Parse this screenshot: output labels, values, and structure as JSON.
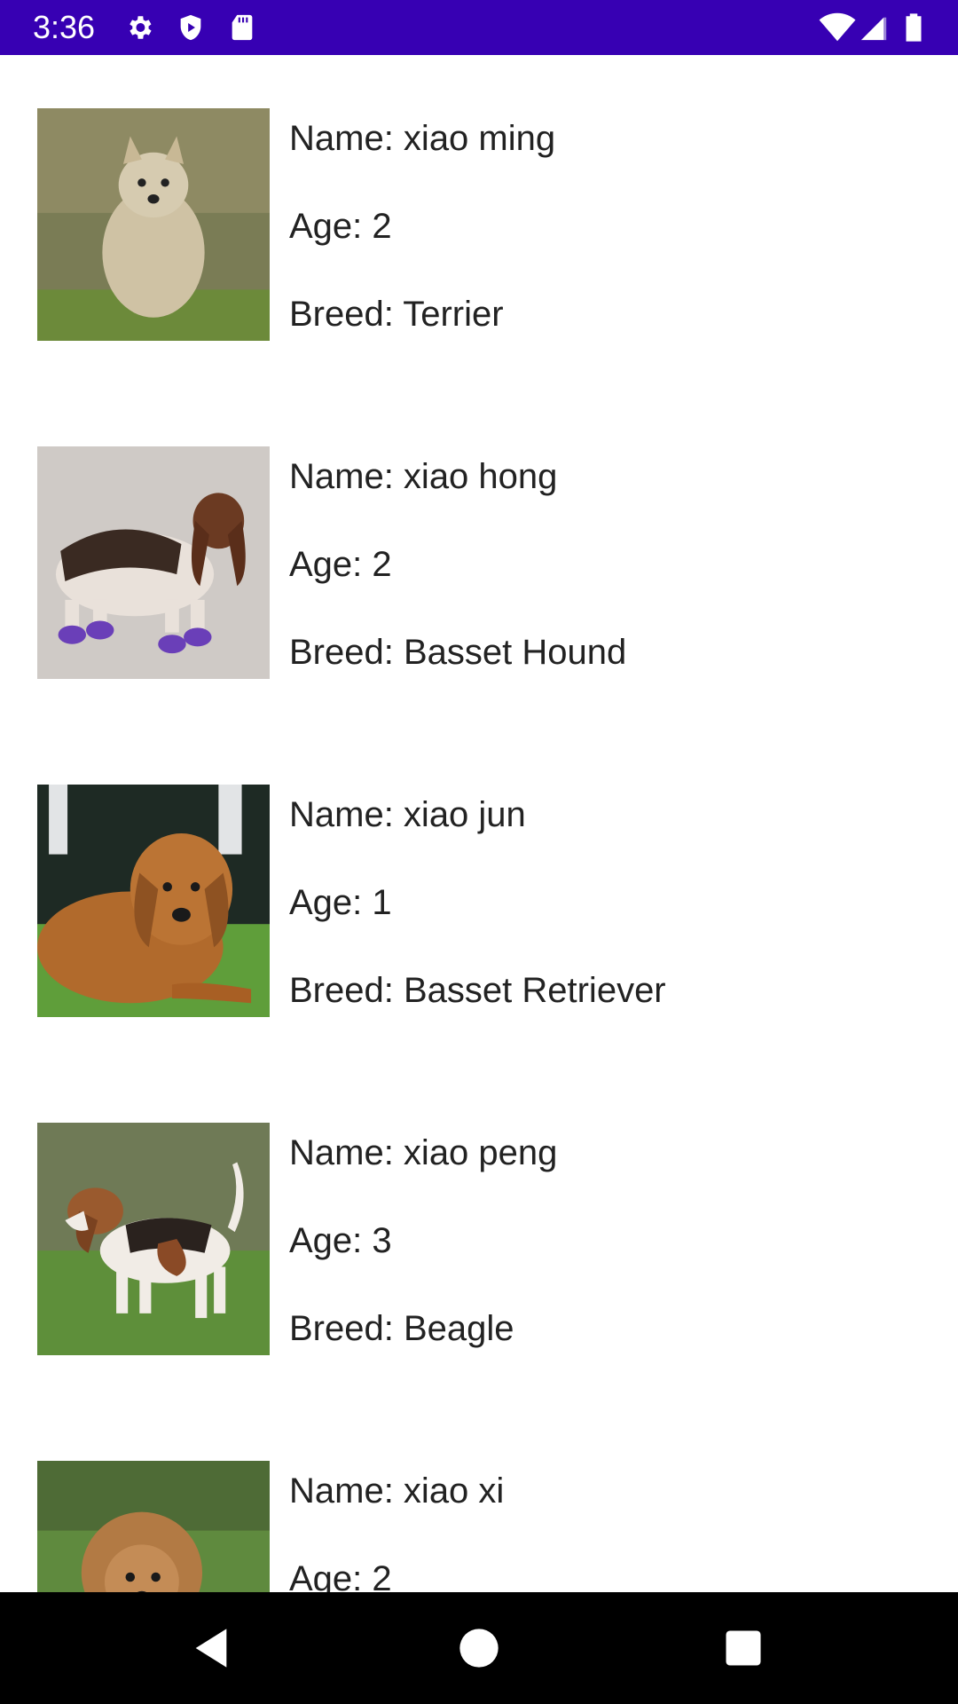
{
  "status_bar": {
    "time": "3:36",
    "left_icons": [
      "gear-icon",
      "shield-icon",
      "sd-card-icon"
    ],
    "right_icons": [
      "wifi-icon",
      "cell-signal-icon",
      "battery-icon"
    ],
    "color": "#3700b3"
  },
  "dogs": [
    {
      "name": "Name: xiao ming",
      "age": "Age: 2",
      "breed": "Breed: Terrier",
      "photo_icon": "terrier-photo"
    },
    {
      "name": "Name: xiao hong",
      "age": "Age: 2",
      "breed": "Breed: Basset Hound",
      "photo_icon": "basset-hound-photo"
    },
    {
      "name": "Name: xiao jun",
      "age": "Age: 1",
      "breed": "Breed: Basset Retriever",
      "photo_icon": "retriever-photo"
    },
    {
      "name": "Name: xiao peng",
      "age": "Age: 3",
      "breed": "Breed: Beagle",
      "photo_icon": "beagle-photo"
    },
    {
      "name": "Name: xiao xi",
      "age": "Age: 2",
      "breed": "",
      "photo_icon": "poodle-photo"
    }
  ],
  "nav_bar": {
    "buttons": [
      "back-icon",
      "home-icon",
      "recents-icon"
    ]
  }
}
